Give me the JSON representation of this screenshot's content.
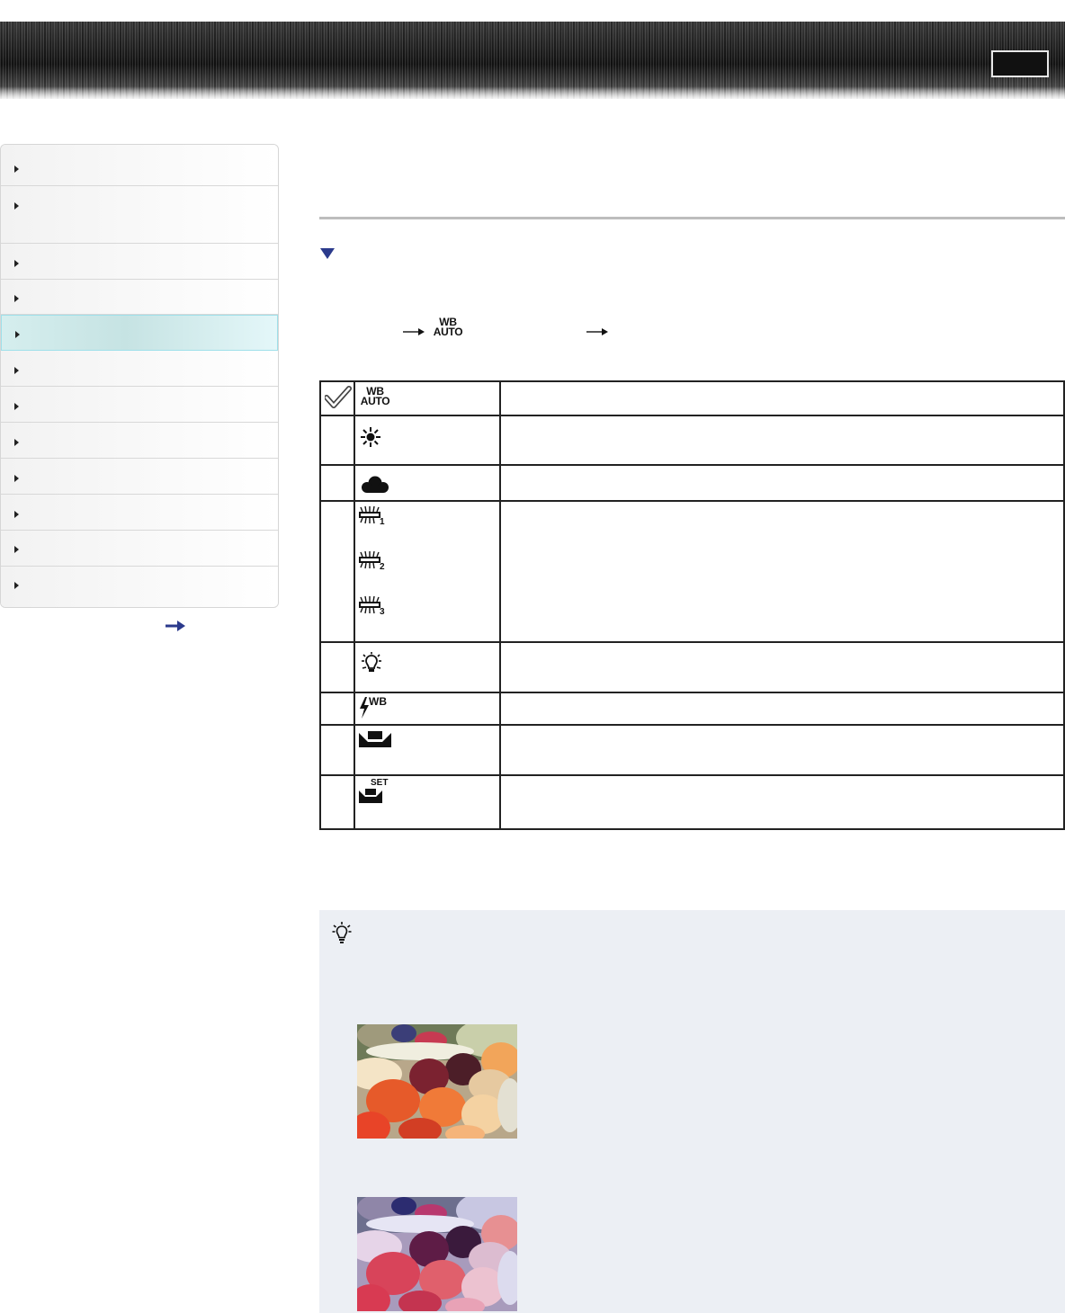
{
  "header": {
    "top_button_label": ""
  },
  "sidebar": {
    "items": [
      {
        "label": ""
      },
      {
        "label": ""
      },
      {
        "label": ""
      },
      {
        "label": ""
      },
      {
        "label": ""
      },
      {
        "label": ""
      },
      {
        "label": ""
      },
      {
        "label": ""
      },
      {
        "label": ""
      },
      {
        "label": ""
      },
      {
        "label": ""
      },
      {
        "label": ""
      }
    ],
    "active_index": 4,
    "more_arrow_icon": "right-arrow-icon"
  },
  "main": {
    "title": "",
    "section_title": "",
    "path_icon": {
      "line1": "WB",
      "line2": "AUTO"
    },
    "table": {
      "rows": [
        {
          "icon": "wb-auto-icon",
          "icon_text": [
            "WB",
            "AUTO"
          ],
          "default": true,
          "desc": ""
        },
        {
          "icon": "daylight-sun-icon",
          "desc": ""
        },
        {
          "icon": "cloudy-icon",
          "desc": ""
        },
        {
          "icon": "fluorescent-icons",
          "numbers": [
            "1",
            "2",
            "3"
          ],
          "desc": ""
        },
        {
          "icon": "incandescent-bulb-icon",
          "desc": ""
        },
        {
          "icon": "flash-wb-icon",
          "icon_text": "WB",
          "desc": ""
        },
        {
          "icon": "one-push-icon",
          "desc": ""
        },
        {
          "icon": "one-push-set-icon",
          "icon_text": "SET",
          "desc": ""
        }
      ]
    },
    "tip": {
      "icon": "lightbulb-hint-icon",
      "images": [
        "fruit-photo-warm",
        "fruit-photo-cool"
      ]
    }
  },
  "colors": {
    "accent": "#2b3a8c",
    "active_sidebar": "#d5eeee",
    "tip_bg": "#eceff4"
  }
}
